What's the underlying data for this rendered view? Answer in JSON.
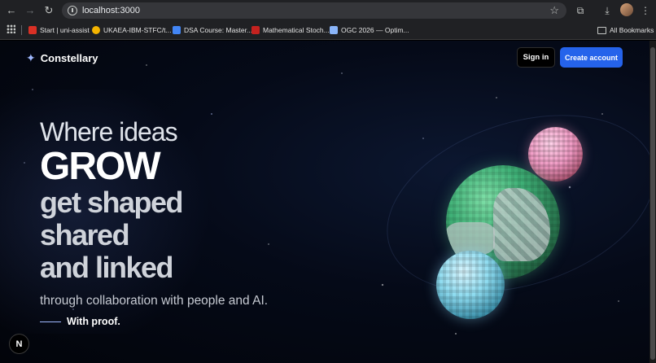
{
  "browser": {
    "url": "localhost:3000",
    "bookmarks": [
      {
        "label": "Start | uni-assist",
        "color": "#d93025"
      },
      {
        "label": "UKAEA-IBM-STFC/t...",
        "color": "#f4b400"
      },
      {
        "label": "DSA Course: Master...",
        "color": "#4285f4"
      },
      {
        "label": "Mathematical Stoch...",
        "color": "#c5221f"
      },
      {
        "label": "OGC 2026 — Optim...",
        "color": "#8ab4f8"
      }
    ],
    "all_bookmarks": "All Bookmarks"
  },
  "header": {
    "logo_text": "Constellary",
    "signin_label": "Sign in",
    "create_label": "Create account"
  },
  "hero": {
    "line1": "Where ideas",
    "line2": "GROW",
    "line3": "get shaped",
    "line4": "shared",
    "line5": "and linked",
    "subtitle": "through collaboration with people and AI.",
    "proof": "With proof."
  },
  "badge": "N",
  "colors": {
    "accent": "#2563eb"
  }
}
